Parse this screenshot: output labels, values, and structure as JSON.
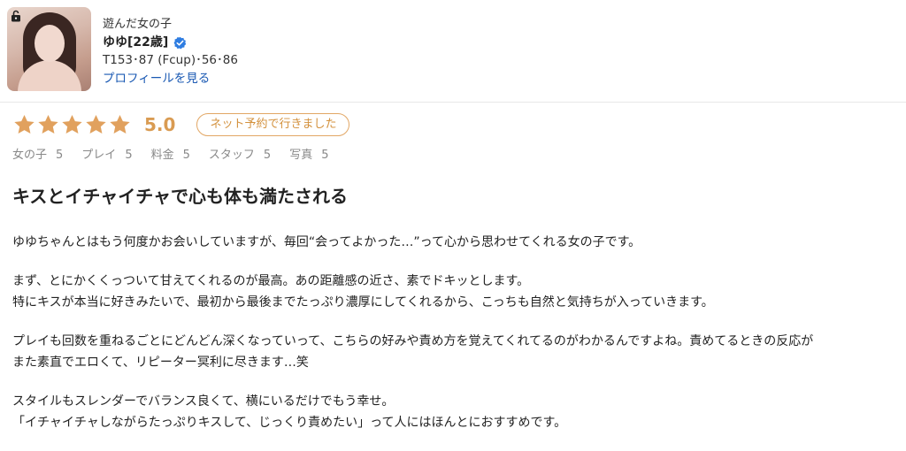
{
  "reviewer_card": {
    "type_label": "遊んだ女の子",
    "name": "ゆゆ[22歳]",
    "specs": "T153･87 (Fcup)･56･86",
    "profile_link": "プロフィールを見る"
  },
  "rating": {
    "stars": 5,
    "score": "5.0",
    "booking_badge": "ネット予約で行きました",
    "accent_color": "#e1a15e"
  },
  "sub_ratings": [
    {
      "label": "女の子",
      "value": "5"
    },
    {
      "label": "プレイ",
      "value": "5"
    },
    {
      "label": "料金",
      "value": "5"
    },
    {
      "label": "スタッフ",
      "value": "5"
    },
    {
      "label": "写真",
      "value": "5"
    }
  ],
  "review": {
    "title": "キスとイチャイチャで心も体も満たされる",
    "paragraphs": [
      [
        "ゆゆちゃんとはもう何度かお会いしていますが、毎回“会ってよかった…”って心から思わせてくれる女の子です。"
      ],
      [
        "まず、とにかくくっついて甘えてくれるのが最高。あの距離感の近さ、素でドキッとします。",
        "特にキスが本当に好きみたいで、最初から最後までたっぷり濃厚にしてくれるから、こっちも自然と気持ちが入っていきます。"
      ],
      [
        "プレイも回数を重ねるごとにどんどん深くなっていって、こちらの好みや責め方を覚えてくれてるのがわかるんですよね。責めてるときの反応が",
        "また素直でエロくて、リピーター冥利に尽きます…笑"
      ],
      [
        "スタイルもスレンダーでバランス良くて、横にいるだけでもう幸せ。",
        "「イチャイチャしながらたっぷりキスして、じっくり責めたい」って人にはほんとにおすすめです。"
      ]
    ]
  },
  "icons": {
    "avatar_lock": "unlock-icon",
    "verified": "verified-check-icon",
    "star": "star-icon"
  }
}
